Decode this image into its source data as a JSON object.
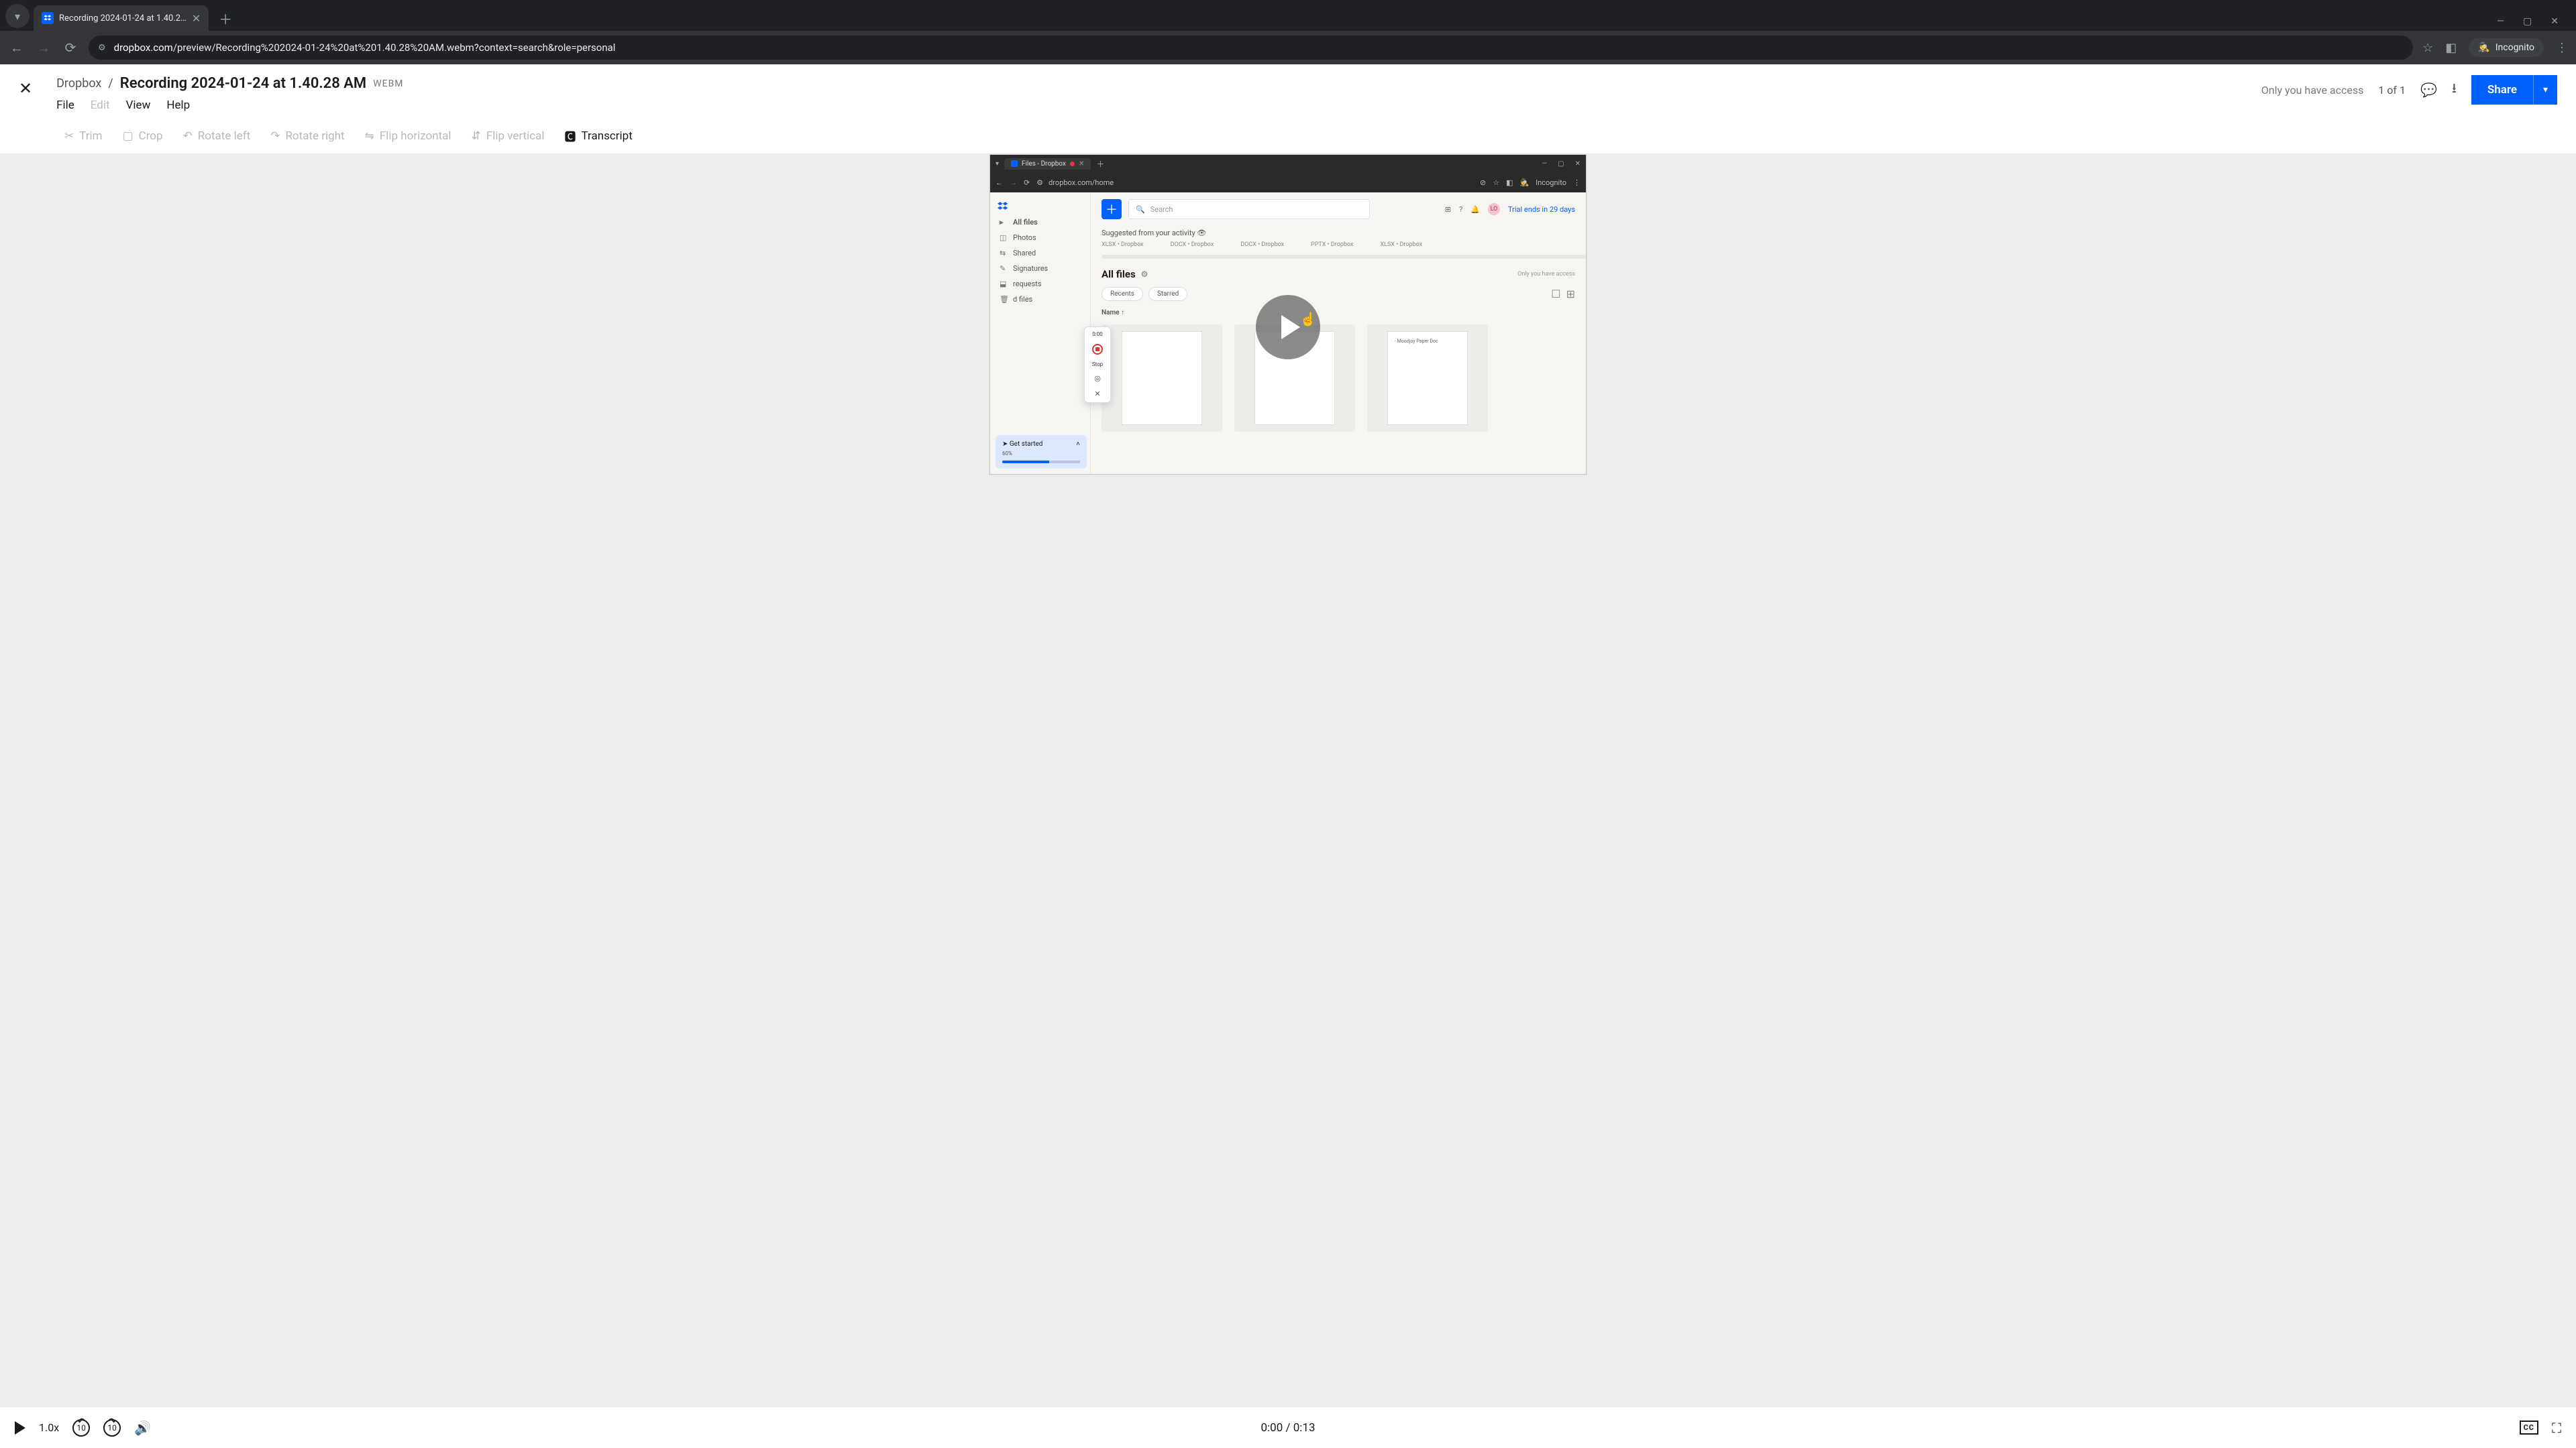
{
  "browser": {
    "tab_title": "Recording 2024-01-24 at 1.40.2…",
    "url_domain": "dropbox.com",
    "url_path": "/preview/Recording%202024-01-24%20at%201.40.28%20AM.webm?context=search&role=personal",
    "incognito_label": "Incognito"
  },
  "header": {
    "root": "Dropbox",
    "sep": "/",
    "filename": "Recording 2024-01-24 at 1.40.28 AM",
    "ext": "WEBM",
    "menu": {
      "file": "File",
      "edit": "Edit",
      "view": "View",
      "help": "Help"
    },
    "access": "Only you have access",
    "page_count": "1 of 1",
    "share": "Share"
  },
  "toolbar": {
    "trim": "Trim",
    "crop": "Crop",
    "rotate_left": "Rotate left",
    "rotate_right": "Rotate right",
    "flip_h": "Flip horizontal",
    "flip_v": "Flip vertical",
    "transcript": "Transcript"
  },
  "player": {
    "speed": "1.0x",
    "skip_back": "10",
    "skip_fwd": "10",
    "time": "0:00 / 0:13",
    "cc": "CC"
  },
  "recorded": {
    "tab_title": "Files - Dropbox",
    "url": "dropbox.com/home",
    "incognito": "Incognito",
    "sidebar": {
      "items": [
        {
          "label": "All files"
        },
        {
          "label": "Photos"
        },
        {
          "label": "Shared"
        },
        {
          "label": "Signatures"
        },
        {
          "label": "requests"
        },
        {
          "label": "d files"
        }
      ]
    },
    "search_placeholder": "Search",
    "trial": "Trial ends in 29 days",
    "avatar": "LO",
    "suggested_label": "Suggested from your activity",
    "suggested": [
      "XLSX • Dropbox",
      "DOCX • Dropbox",
      "DOCX • Dropbox",
      "PPTX • Dropbox",
      "XLSX • Dropbox"
    ],
    "allfiles": "All files",
    "access": "Only you have access",
    "chips": {
      "recents": "Recents",
      "starred": "Starred"
    },
    "col_name": "Name",
    "paper_doc": "- Moodjoy Paper Doc",
    "getstarted": {
      "label": "Get started",
      "pct": "60%"
    },
    "popup": {
      "time": "0:00",
      "stop": "Stop"
    }
  }
}
